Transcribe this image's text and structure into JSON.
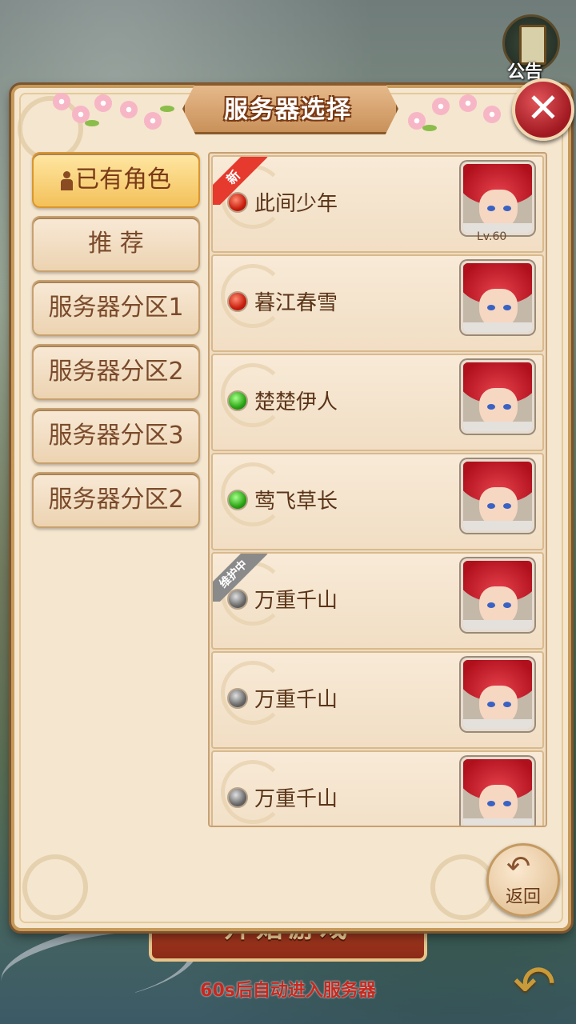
{
  "header": {
    "notice_label": "公告",
    "title": "服务器选择"
  },
  "tabs": [
    {
      "label": "已有角色",
      "active": true
    },
    {
      "label": "推 荐",
      "active": false
    },
    {
      "label": "服务器分区1",
      "active": false
    },
    {
      "label": "服务器分区2",
      "active": false
    },
    {
      "label": "服务器分区3",
      "active": false
    },
    {
      "label": "服务器分区2",
      "active": false
    }
  ],
  "servers": [
    {
      "name": "此间少年",
      "status": "red",
      "tag": "新",
      "level": "Lv.60",
      "avatar": "red-hair-hero-avatar"
    },
    {
      "name": "暮江春雪",
      "status": "red",
      "tag": "",
      "level": "",
      "avatar": "red-hair-hero-avatar"
    },
    {
      "name": "楚楚伊人",
      "status": "green",
      "tag": "",
      "level": "",
      "avatar": "red-hair-hero-avatar"
    },
    {
      "name": "莺飞草长",
      "status": "green",
      "tag": "",
      "level": "",
      "avatar": "red-hair-hero-avatar"
    },
    {
      "name": "万重千山",
      "status": "gray",
      "tag": "维护中",
      "level": "",
      "avatar": "red-hair-hero-avatar"
    },
    {
      "name": "万重千山",
      "status": "gray",
      "tag": "",
      "level": "",
      "avatar": "red-hair-hero-avatar"
    },
    {
      "name": "万重千山",
      "status": "gray",
      "tag": "",
      "level": "",
      "avatar": "red-hair-hero-avatar"
    }
  ],
  "return_button": {
    "label": "返回",
    "icon": "return-arrow-icon"
  },
  "footer": {
    "start_button": "开始游戏",
    "auto_enter_text": "60s后自动进入服务器"
  },
  "colors": {
    "status_red": "#c81e0e",
    "status_green": "#2aa414",
    "status_gray": "#6a6a6a",
    "tag_new": "#e63a2e",
    "tag_maintenance": "#8a8a8a",
    "auto_text": "#c8281e"
  }
}
